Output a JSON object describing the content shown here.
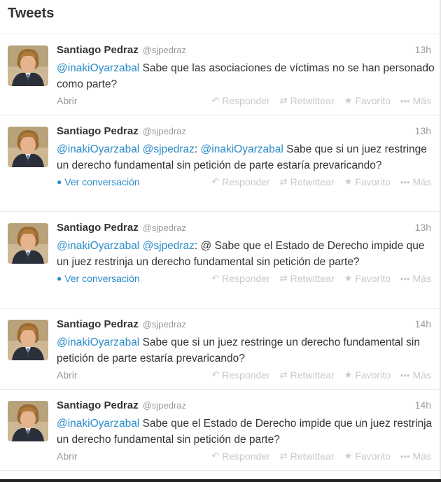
{
  "header": {
    "title": "Tweets"
  },
  "actions": {
    "reply": "Responder",
    "retweet": "Retwittear",
    "favorite": "Favorito",
    "more": "Más"
  },
  "tweets": [
    {
      "fullname": "Santiago Pedraz",
      "username": "@sjpedraz",
      "time": "13h",
      "segments": [
        {
          "text": "@inakiOyarzabal",
          "mention": true
        },
        {
          "text": " Sabe que las asociaciones de víctimas no se han personado como parte?",
          "mention": false
        }
      ],
      "footer_link": "Abrir",
      "footer_type": "expand"
    },
    {
      "fullname": "Santiago Pedraz",
      "username": "@sjpedraz",
      "time": "13h",
      "segments": [
        {
          "text": "@inakiOyarzabal",
          "mention": true
        },
        {
          "text": " ",
          "mention": false
        },
        {
          "text": "@sjpedraz",
          "mention": true
        },
        {
          "text": ": ",
          "mention": false
        },
        {
          "text": "@inakiOyarzabal",
          "mention": true
        },
        {
          "text": " Sabe que si un juez restringe un derecho fundamental sin petición de parte estaría prevaricando?",
          "mention": false
        }
      ],
      "footer_link": "Ver conversación",
      "footer_type": "conversation"
    },
    {
      "fullname": "Santiago Pedraz",
      "username": "@sjpedraz",
      "time": "13h",
      "segments": [
        {
          "text": "@inakiOyarzabal",
          "mention": true
        },
        {
          "text": " ",
          "mention": false
        },
        {
          "text": "@sjpedraz",
          "mention": true
        },
        {
          "text": ": @ Sabe que el Estado de Derecho impide que un juez restrinja un derecho fundamental sin petición de parte?",
          "mention": false
        }
      ],
      "footer_link": "Ver conversación",
      "footer_type": "conversation"
    },
    {
      "fullname": "Santiago Pedraz",
      "username": "@sjpedraz",
      "time": "14h",
      "segments": [
        {
          "text": "@inakiOyarzabal",
          "mention": true
        },
        {
          "text": " Sabe que si un juez restringe un derecho fundamental sin petición de parte estaría prevaricando?",
          "mention": false
        }
      ],
      "footer_link": "Abrir",
      "footer_type": "expand"
    },
    {
      "fullname": "Santiago Pedraz",
      "username": "@sjpedraz",
      "time": "14h",
      "segments": [
        {
          "text": "@inakiOyarzabal",
          "mention": true
        },
        {
          "text": " Sabe que el Estado de Derecho impide que un juez restrinja un derecho fundamental sin petición de parte?",
          "mention": false
        }
      ],
      "footer_link": "Abrir",
      "footer_type": "expand"
    }
  ]
}
